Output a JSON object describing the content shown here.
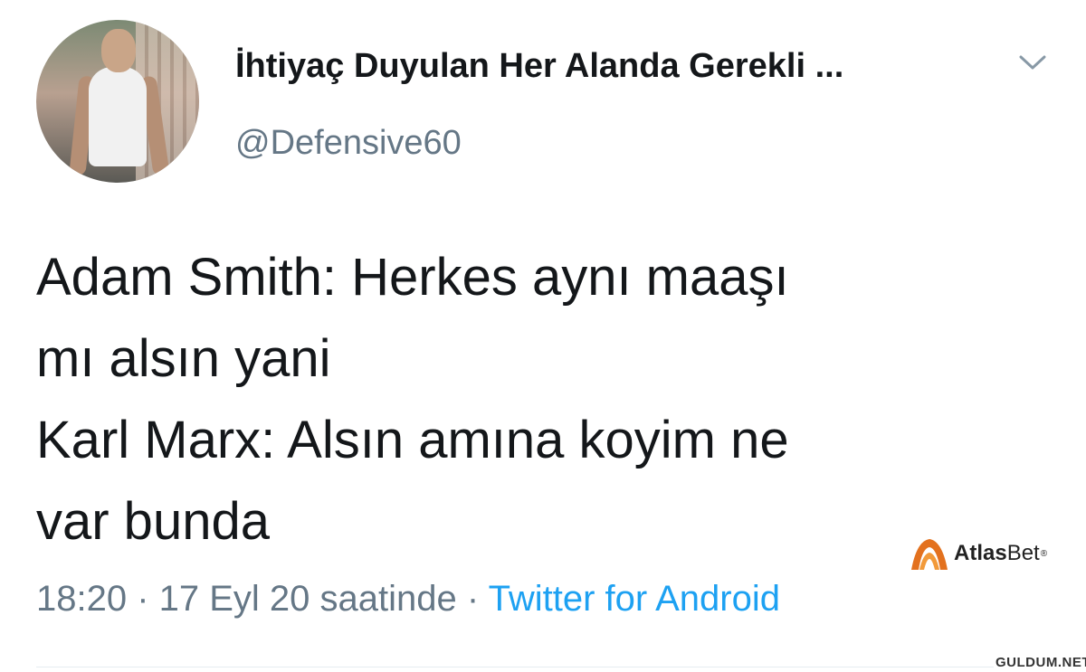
{
  "profile": {
    "display_name": "İhtiyaç Duyulan Her Alanda Gerekli ...",
    "handle": "@Defensive60"
  },
  "tweet": {
    "lines": [
      "Adam Smith: Herkes aynı maaşı",
      "mı alsın yani",
      "Karl Marx: Alsın amına koyim ne",
      "var bunda"
    ],
    "timestamp": "18:20 · 17 Eyl 20 saatinde · ",
    "source": "Twitter for Android"
  },
  "branding": {
    "logo_text_atlas": "Atlas",
    "logo_text_bet": "Bet",
    "logo_reg": "®",
    "logo_color": "#e3711e",
    "watermark": "GULDUM.NET"
  },
  "icons": {
    "menu": "chevron-down-icon"
  },
  "colors": {
    "text": "#14171a",
    "muted": "#657786",
    "link": "#1da1f2"
  }
}
